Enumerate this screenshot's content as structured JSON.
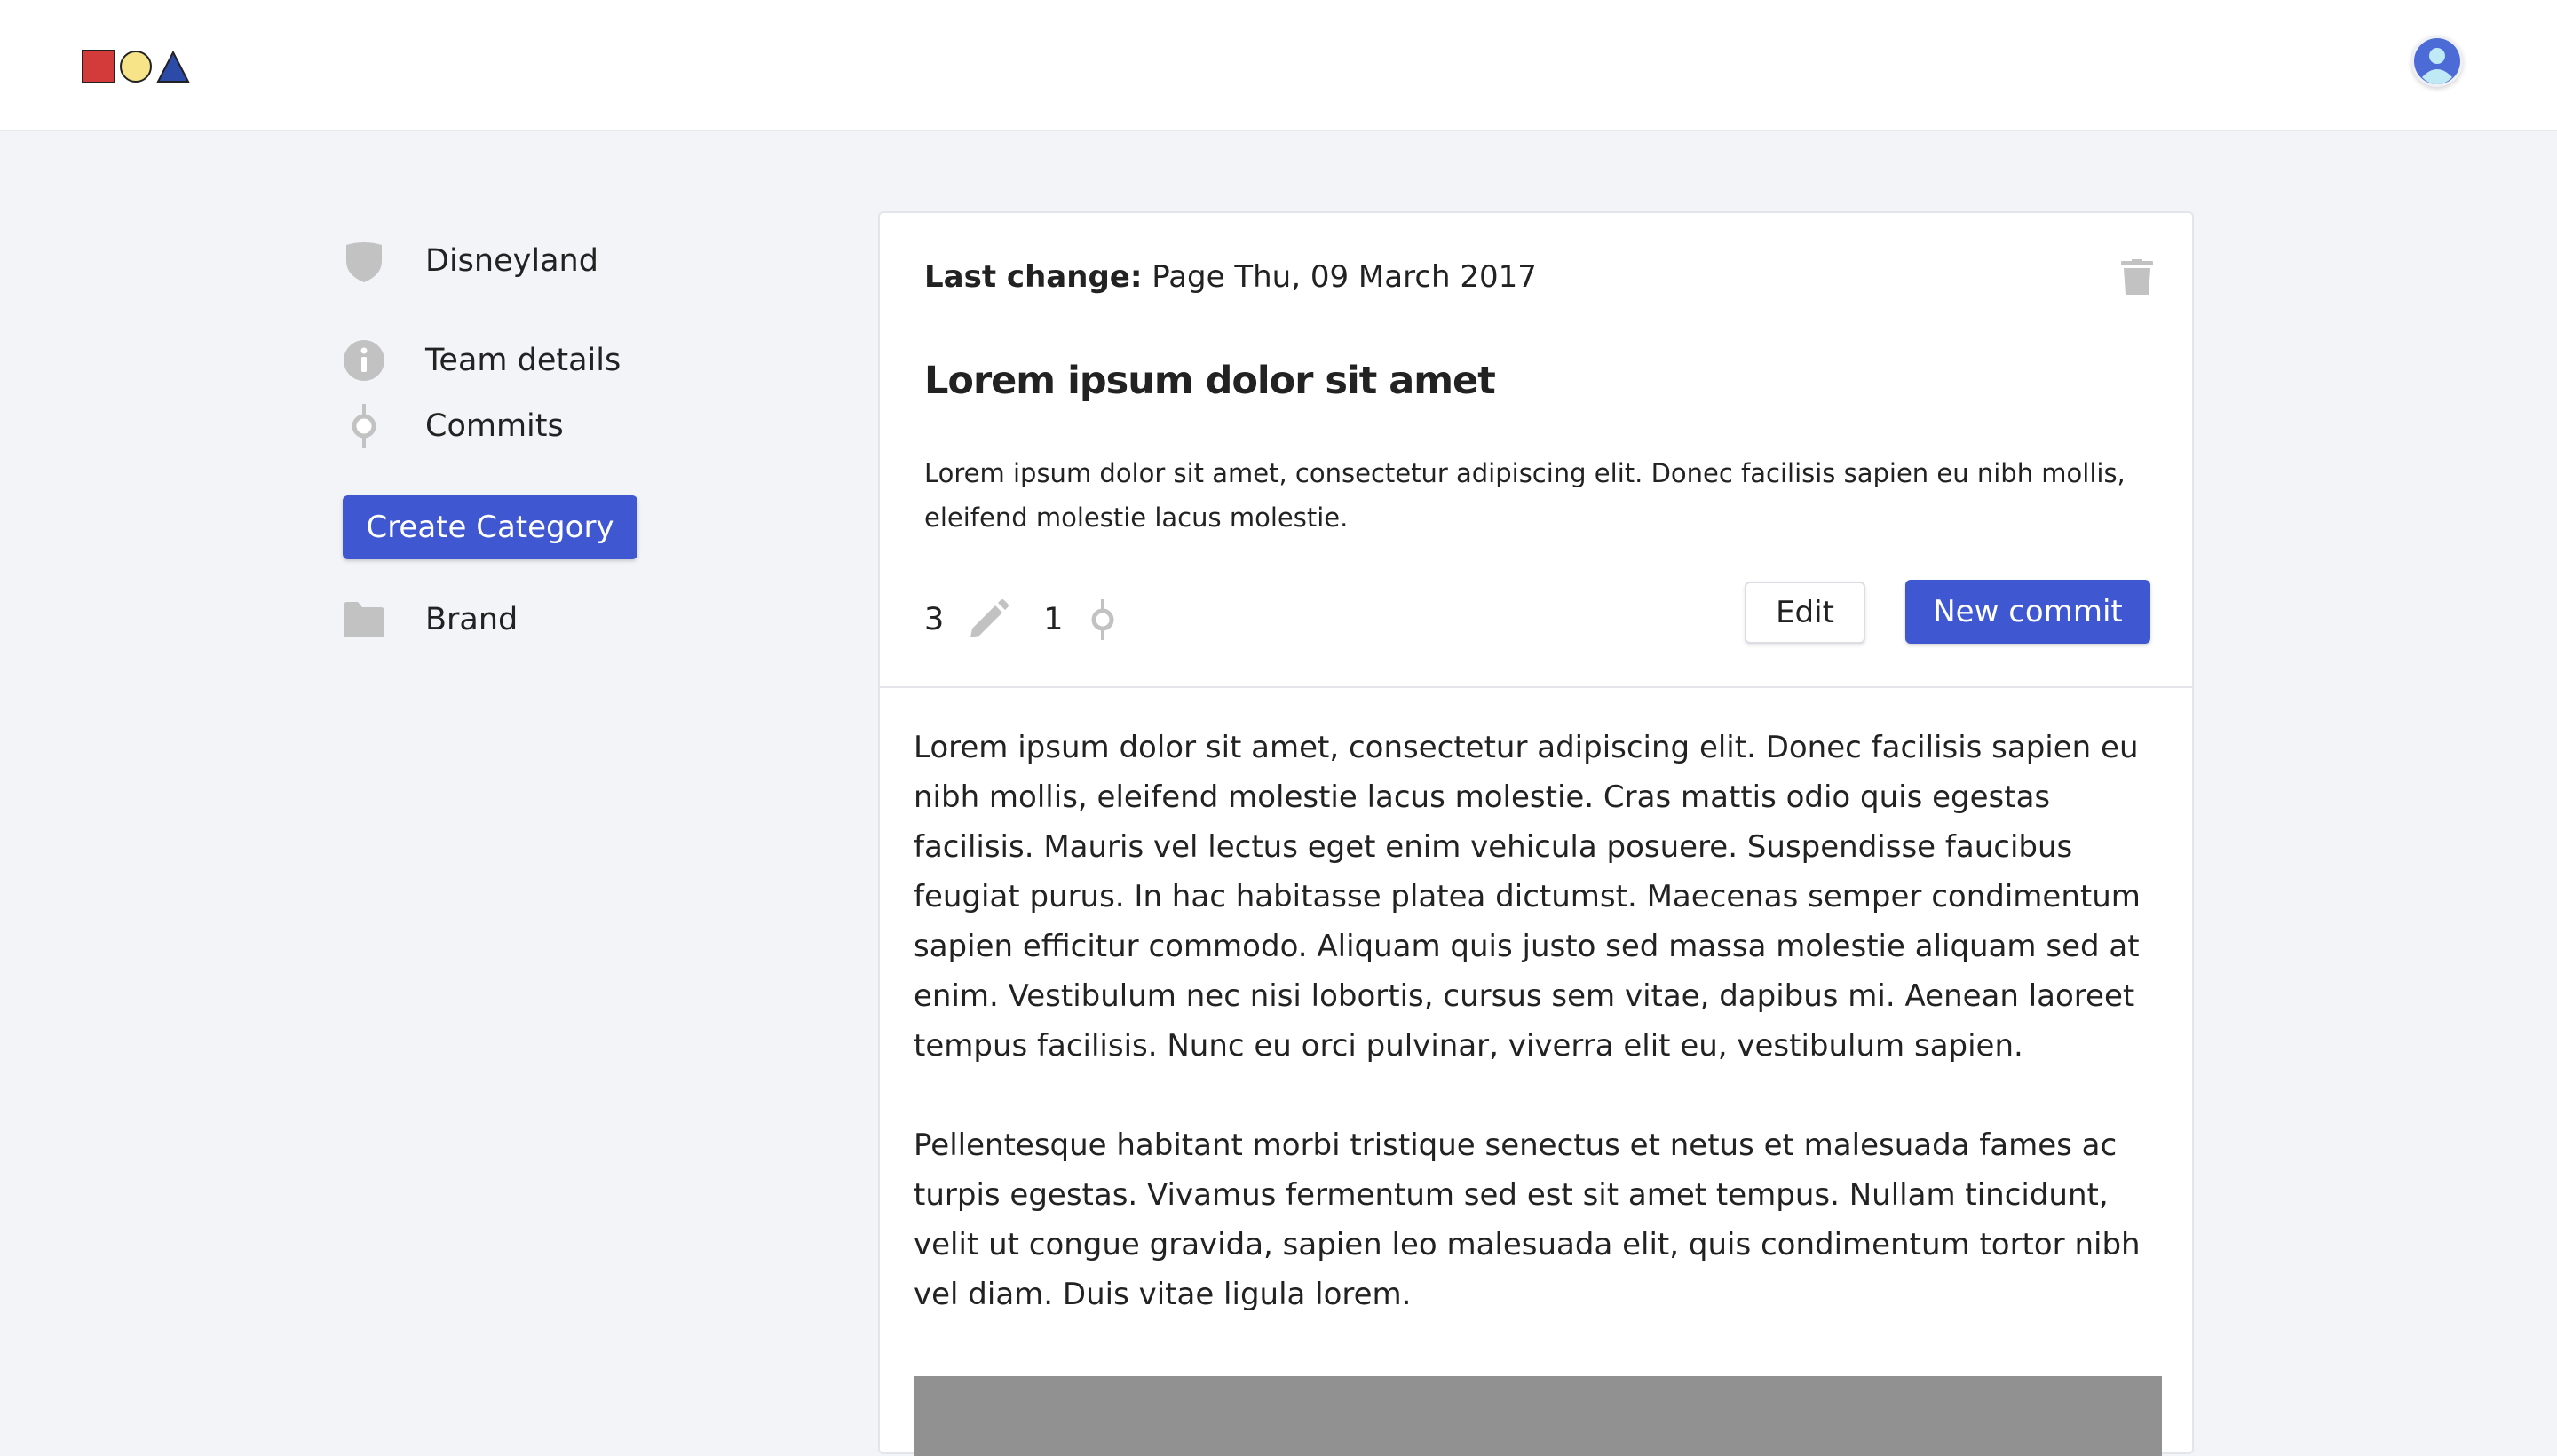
{
  "header": {
    "logo_icons": [
      "red-square-icon",
      "yellow-circle-icon",
      "blue-triangle-icon"
    ],
    "avatar_icon": "user-avatar-icon"
  },
  "sidebar": {
    "project": {
      "label": "Disneyland",
      "icon": "shield-icon"
    },
    "items": [
      {
        "label": "Team details",
        "icon": "info-icon"
      },
      {
        "label": "Commits",
        "icon": "commit-icon"
      }
    ],
    "create_button": "Create Category",
    "categories": [
      {
        "label": "Brand",
        "icon": "folder-icon"
      }
    ]
  },
  "card": {
    "last_change_label": "Last change:",
    "last_change_value": "Page Thu, 09 March 2017",
    "title": "Lorem ipsum dolor sit amet",
    "summary": "Lorem ipsum dolor sit amet, consectetur adipiscing elit. Donec facilisis sapien eu nibh mollis, eleifend molestie lacus molestie.",
    "edits_count": "3",
    "commits_count": "1",
    "edit_button": "Edit",
    "new_commit_button": "New commit",
    "paragraphs": [
      "Lorem ipsum dolor sit amet, consectetur adipiscing elit. Donec facilisis sapien eu nibh mollis, eleifend molestie lacus molestie. Cras mattis odio quis egestas facilisis. Mauris vel lectus eget enim vehicula posuere. Suspendisse faucibus feugiat purus. In hac habitasse platea dictumst. Maecenas semper condimentum sapien efficitur commodo. Aliquam quis justo sed massa molestie aliquam sed at enim. Vestibulum nec nisi lobortis, cursus sem vitae, dapibus mi. Aenean laoreet tempus facilisis. Nunc eu orci pulvinar, viverra elit eu, vestibulum sapien.",
      "Pellentesque habitant morbi tristique senectus et netus et malesuada fames ac turpis egestas. Vivamus fermentum sed est sit amet tempus. Nullam tincidunt, velit ut congue gravida, sapien leo malesuada elit, quis condimentum tortor nibh vel diam. Duis vitae ligula lorem."
    ]
  },
  "colors": {
    "accent": "#3f57d1",
    "icon_gray": "#c2c2c2",
    "background": "#f3f4f8"
  }
}
